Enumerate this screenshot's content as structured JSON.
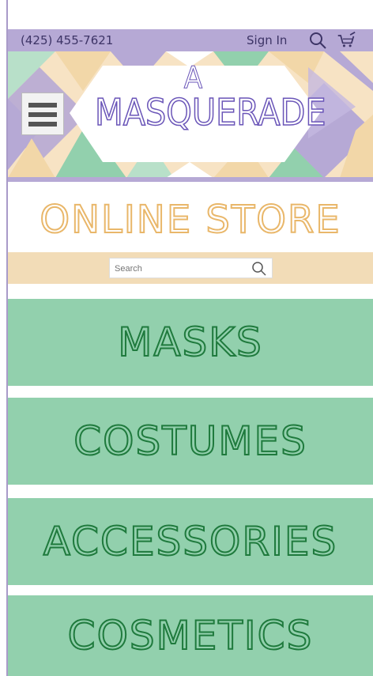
{
  "header": {
    "phone": "(425) 455-7621",
    "sign_in": "Sign In",
    "search_icon": "search-icon",
    "cart_icon": "cart-icon"
  },
  "brand": {
    "line1": "A",
    "line2": "MASQUERADE"
  },
  "store": {
    "title": "ONLINE STORE",
    "search_placeholder": "Search"
  },
  "categories": [
    {
      "label": "MASKS"
    },
    {
      "label": "COSTUMES"
    },
    {
      "label": "ACCESSORIES"
    },
    {
      "label": "COSMETICS"
    }
  ],
  "colors": {
    "purple": "#b6a9d5",
    "peach": "#f2dcb7",
    "green": "#92d0ad",
    "dark_green": "#1f7a3d",
    "gold": "#e9b76a",
    "brand_purple": "#6a55b8"
  }
}
